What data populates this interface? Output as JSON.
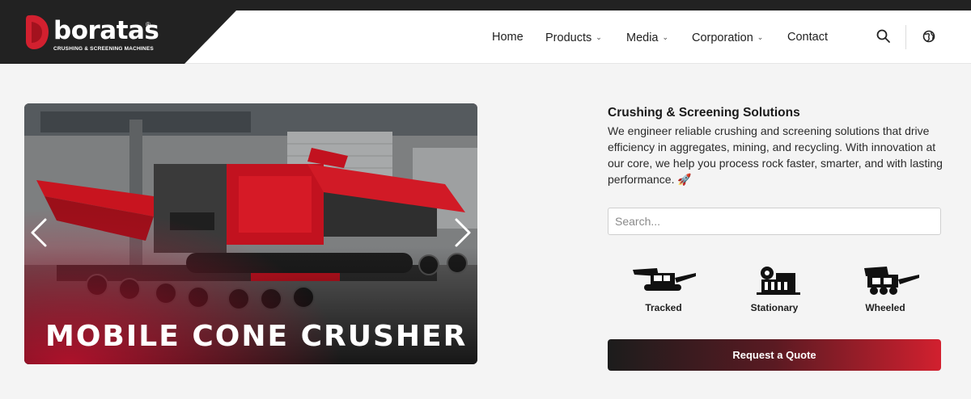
{
  "brand": {
    "name": "boratas",
    "registered": "®",
    "tagline": "CRUSHING & SCREENING MACHINES",
    "accent": "#d2202f",
    "dark": "#222222"
  },
  "nav": {
    "items": [
      {
        "label": "Home",
        "has_dropdown": false
      },
      {
        "label": "Products",
        "has_dropdown": true
      },
      {
        "label": "Media",
        "has_dropdown": true
      },
      {
        "label": "Corporation",
        "has_dropdown": true
      },
      {
        "label": "Contact",
        "has_dropdown": false
      }
    ],
    "dropdown_glyph": "⌄",
    "icons": [
      "search-icon",
      "globe-icon"
    ]
  },
  "slider": {
    "caption": "MOBILE CONE CRUSHER",
    "prev_icon": "chevron-left-icon",
    "next_icon": "chevron-right-icon"
  },
  "panel": {
    "title": "Crushing & Screening Solutions",
    "description": "We engineer reliable crushing and screening solutions that drive efficiency in aggregates, mining, and recycling. With innovation at our core, we help you process rock faster, smarter, and with lasting performance. 🚀",
    "search_placeholder": "Search...",
    "search_value": "",
    "categories": [
      {
        "label": "Tracked",
        "icon": "tracked-crusher-icon"
      },
      {
        "label": "Stationary",
        "icon": "stationary-plant-icon"
      },
      {
        "label": "Wheeled",
        "icon": "wheeled-crusher-icon"
      }
    ],
    "cta_label": "Request a Quote"
  }
}
